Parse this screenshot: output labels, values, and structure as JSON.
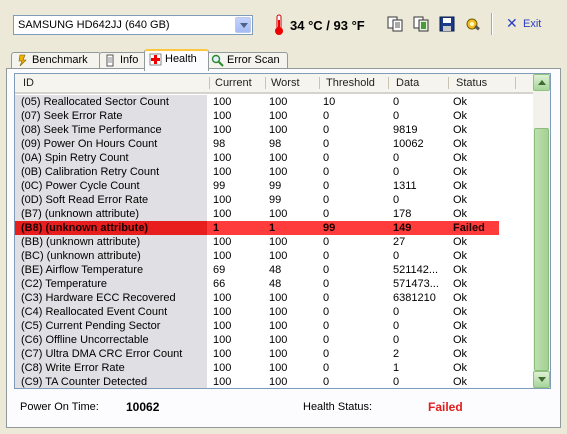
{
  "toolbar": {
    "drive": "SAMSUNG HD642JJ (640 GB)",
    "temperature": "34 °C / 93 °F",
    "exit_label": "Exit",
    "icons": [
      "copy-icon",
      "copy-all-icon",
      "save-icon",
      "options-icon",
      "exit-icon"
    ]
  },
  "tabs": [
    {
      "label": "Benchmark",
      "icon": "benchmark-icon"
    },
    {
      "label": "Info",
      "icon": "info-icon"
    },
    {
      "label": "Health",
      "icon": "health-icon",
      "active": true
    },
    {
      "label": "Error Scan",
      "icon": "magnifier-icon"
    }
  ],
  "table": {
    "headers": [
      "ID",
      "Current",
      "Worst",
      "Threshold",
      "Data",
      "Status"
    ],
    "rows": [
      {
        "id": "(05) Reallocated Sector Count",
        "current": "100",
        "worst": "100",
        "threshold": "10",
        "data": "0",
        "status": "Ok"
      },
      {
        "id": "(07) Seek Error Rate",
        "current": "100",
        "worst": "100",
        "threshold": "0",
        "data": "0",
        "status": "Ok"
      },
      {
        "id": "(08) Seek Time Performance",
        "current": "100",
        "worst": "100",
        "threshold": "0",
        "data": "9819",
        "status": "Ok"
      },
      {
        "id": "(09) Power On Hours Count",
        "current": "98",
        "worst": "98",
        "threshold": "0",
        "data": "10062",
        "status": "Ok"
      },
      {
        "id": "(0A) Spin Retry Count",
        "current": "100",
        "worst": "100",
        "threshold": "0",
        "data": "0",
        "status": "Ok"
      },
      {
        "id": "(0B) Calibration Retry Count",
        "current": "100",
        "worst": "100",
        "threshold": "0",
        "data": "0",
        "status": "Ok"
      },
      {
        "id": "(0C) Power Cycle Count",
        "current": "99",
        "worst": "99",
        "threshold": "0",
        "data": "1311",
        "status": "Ok"
      },
      {
        "id": "(0D) Soft Read Error Rate",
        "current": "100",
        "worst": "99",
        "threshold": "0",
        "data": "0",
        "status": "Ok"
      },
      {
        "id": "(B7) (unknown attribute)",
        "current": "100",
        "worst": "100",
        "threshold": "0",
        "data": "178",
        "status": "Ok"
      },
      {
        "id": "(B8) (unknown attribute)",
        "current": "1",
        "worst": "1",
        "threshold": "99",
        "data": "149",
        "status": "Failed",
        "failed": true
      },
      {
        "id": "(BB) (unknown attribute)",
        "current": "100",
        "worst": "100",
        "threshold": "0",
        "data": "27",
        "status": "Ok"
      },
      {
        "id": "(BC) (unknown attribute)",
        "current": "100",
        "worst": "100",
        "threshold": "0",
        "data": "0",
        "status": "Ok"
      },
      {
        "id": "(BE) Airflow Temperature",
        "current": "69",
        "worst": "48",
        "threshold": "0",
        "data": "521142...",
        "status": "Ok"
      },
      {
        "id": "(C2) Temperature",
        "current": "66",
        "worst": "48",
        "threshold": "0",
        "data": "571473...",
        "status": "Ok"
      },
      {
        "id": "(C3) Hardware ECC Recovered",
        "current": "100",
        "worst": "100",
        "threshold": "0",
        "data": "6381210",
        "status": "Ok"
      },
      {
        "id": "(C4) Reallocated Event Count",
        "current": "100",
        "worst": "100",
        "threshold": "0",
        "data": "0",
        "status": "Ok"
      },
      {
        "id": "(C5) Current Pending Sector",
        "current": "100",
        "worst": "100",
        "threshold": "0",
        "data": "0",
        "status": "Ok"
      },
      {
        "id": "(C6) Offline Uncorrectable",
        "current": "100",
        "worst": "100",
        "threshold": "0",
        "data": "0",
        "status": "Ok"
      },
      {
        "id": "(C7) Ultra DMA CRC Error Count",
        "current": "100",
        "worst": "100",
        "threshold": "0",
        "data": "2",
        "status": "Ok"
      },
      {
        "id": "(C8) Write Error Rate",
        "current": "100",
        "worst": "100",
        "threshold": "0",
        "data": "1",
        "status": "Ok"
      },
      {
        "id": "(C9) TA Counter Detected",
        "current": "100",
        "worst": "100",
        "threshold": "0",
        "data": "0",
        "status": "Ok"
      }
    ]
  },
  "footer": {
    "power_on_label": "Power On Time:",
    "power_on_value": "10062",
    "health_label": "Health Status:",
    "health_value": "Failed",
    "health_color": "#e31d1d"
  }
}
